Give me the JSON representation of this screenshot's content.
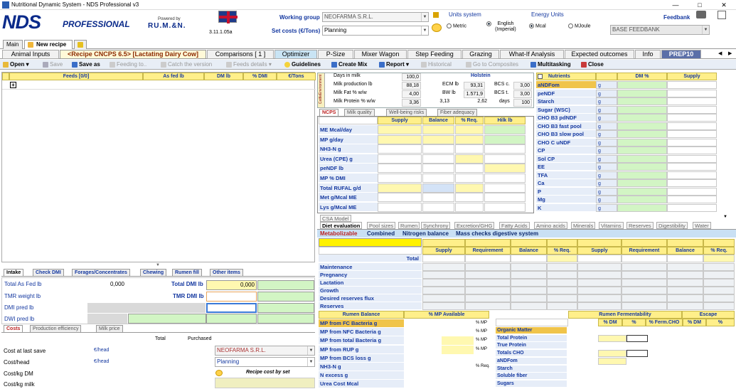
{
  "window": {
    "title": "Nutritional Dynamic System - NDS Professional v3"
  },
  "brand": {
    "logo": "NDS",
    "logo2": "PROFESSIONAL",
    "powered": "Powered by",
    "company": "RU.M.&N.",
    "version": "3.11.1.05a"
  },
  "header": {
    "working_group_label": "Working group",
    "working_group_value": "NEOFARMA S.R.L.",
    "set_costs_label": "Set costs (€/Tons)",
    "set_costs_value": "Planning",
    "units_title": "Units system",
    "unit_metric": "Metric",
    "unit_english": "English (Imperial)",
    "energy_title": "Energy Units",
    "energy_mcal": "Mcal",
    "energy_mjoule": "MJoule",
    "feedbank_label": "Feedbank",
    "feedbank_value": "BASE FEEDBANK"
  },
  "doc_tabs": [
    "Main",
    "New recipe"
  ],
  "main_tabs": [
    "Animal Inputs",
    "<Recipe CNCPS 6.5> [Lactating Dairy Cow]",
    "Comparisons [ 1 ]",
    "Optimizer",
    "P-Size",
    "Mixer Wagon",
    "Step Feeding",
    "Grazing",
    "What-If Analysis",
    "Expected outcomes",
    "Info",
    "PREP10"
  ],
  "toolbar": {
    "open": "Open",
    "save": "Save",
    "save_as": "Save as",
    "feeding_to": "Feeding to..",
    "catch": "Catch the version",
    "feeds_details": "Feeds details",
    "guidelines": "Guidelines",
    "create_mix": "Create Mix",
    "report": "Report",
    "historical": "Historical",
    "go_composites": "Go to Composites",
    "multitasking": "Multitasking",
    "close": "Close"
  },
  "feeds_grid": {
    "headers": [
      "Feeds [0/0]",
      "As fed lb",
      "DM lb",
      "% DMI",
      "€/Tons"
    ]
  },
  "animal_info": {
    "rows": [
      {
        "label": "Days in milk",
        "v1": "100,0",
        "label2": "Holstein",
        "v2": "",
        "label3": "",
        "v3": ""
      },
      {
        "label": "Milk production lb",
        "v1": "88,18",
        "label2": "ECM lb",
        "v2": "93,31",
        "label3": "BCS c.",
        "v3": "3,00"
      },
      {
        "label": "Milk Fat % w/w",
        "v1": "4,00",
        "label2": "BW lb",
        "v2": "1.571,9",
        "label3": "BCS t.",
        "v3": "3,00"
      },
      {
        "label": "Milk Protein % w/w",
        "v1": "3,36",
        "label2": "3,13",
        "v2": "2,62",
        "label3": "days",
        "v3": "100"
      }
    ],
    "side_labels": [
      "Environment",
      "Cattle"
    ]
  },
  "ncps_tabs": [
    "NCPS",
    "Milk quality",
    "Well-being risks",
    "Fiber adequacy"
  ],
  "ncps": {
    "headers": [
      "Supply",
      "Balance",
      "% Req.",
      "Hilk lb"
    ],
    "rows": [
      "ME Mcal/day",
      "MP g/day",
      "NH3-N g",
      "Urea (CPE) g",
      "peNDF lb",
      "MP % DMI",
      "Total RUFAL g/d",
      "Met g/Mcal ME",
      "Lys g/Mcal ME"
    ]
  },
  "nutrients": {
    "headers": [
      "Nutrients",
      "DM %",
      "Supply"
    ],
    "unit": "g",
    "rows": [
      "aNDFom",
      "peNDF",
      "Starch",
      "Sugar (WSC)",
      "CHO B3 pdNDF",
      "CHO B3 fast pool",
      "CHO B3 slow pool",
      "CHO C uNDF",
      "CP",
      "Sol CP",
      "EE",
      "TFA",
      "Ca",
      "P",
      "Mg",
      "K"
    ]
  },
  "intake_tabs": [
    "Intake",
    "Check DMI",
    "Forages/Concentrates",
    "Chewing",
    "Rumen fill",
    "Other items"
  ],
  "intake": {
    "total_as_fed": "Total As Fed lb",
    "total_as_fed_v": "0,000",
    "total_dmi": "Total DMI lb",
    "total_dmi_v": "0,000",
    "tmr_weight": "TMR weight lb",
    "tmr_dmi": "TMR DMI lb",
    "dmi_pred": "DMI pred lb",
    "dwi_pred": "DWI pred lb"
  },
  "costs_tabs": [
    "Costs",
    "Production efficiency",
    "Milk price"
  ],
  "costs": {
    "col_total": "Total",
    "col_purchased": "Purchased",
    "rows": [
      {
        "label": "Cost at last save",
        "unit": "€/head"
      },
      {
        "label": "Cost/head",
        "unit": "€/head"
      },
      {
        "label": "Cost/kg DM",
        "unit": ""
      },
      {
        "label": "Cost/kg milk",
        "unit": ""
      }
    ],
    "supplier": "NEOFARMA S.R.L.",
    "plan": "Planning",
    "recipe_cost": "Recipe cost by set"
  },
  "model_tab": "CSA Model",
  "diet_tabs": [
    "Diet evaluation",
    "Pool sizes",
    "Rumen",
    "Synchrony",
    "Excretion/GHG",
    "Fatty Acids",
    "Amino acids",
    "Minerals",
    "Vitamins",
    "Reserves",
    "Digestibility",
    "Water"
  ],
  "diet_subtabs": [
    "Metabolizable",
    "Combined",
    "Nitrogen balance",
    "Mass checks digestive system"
  ],
  "diet": {
    "headers": [
      "Supply",
      "Requirement",
      "Balance",
      "% Req.",
      "Supply",
      "Requirement",
      "Balance",
      "% Req."
    ],
    "total": "Total",
    "rows": [
      "Maintenance",
      "Pregnancy",
      "Lactation",
      "Growth",
      "Desired reserves flux",
      "Reserves"
    ]
  },
  "rumen_balance": {
    "title": "Rumen Balance",
    "col": "% MP Available",
    "rows": [
      {
        "label": "MP from FC Bacteria g",
        "unit": "% MP"
      },
      {
        "label": "MP from NFC Bacteria g",
        "unit": "% MP"
      },
      {
        "label": "MP from total Bacteria g",
        "unit": "% MP"
      },
      {
        "label": "MP from RUP g",
        "unit": "% MP"
      },
      {
        "label": "MP from BCS loss g",
        "unit": ""
      },
      {
        "label": "NH3-N g",
        "unit": "% Req."
      },
      {
        "label": "N excess g",
        "unit": ""
      },
      {
        "label": "Urea Cost Mcal",
        "unit": ""
      }
    ]
  },
  "fermentability": {
    "title": "Rumen Fermentability",
    "escape": "Escape",
    "headers": [
      "% DM",
      "%",
      "% Ferm.CHO",
      "% DM",
      "%"
    ],
    "rows": [
      "Organic Matter",
      "Total Protein",
      "True Protein",
      "Totals CHO",
      "aNDFom",
      "Starch",
      "Soluble fiber",
      "Sugars"
    ]
  }
}
